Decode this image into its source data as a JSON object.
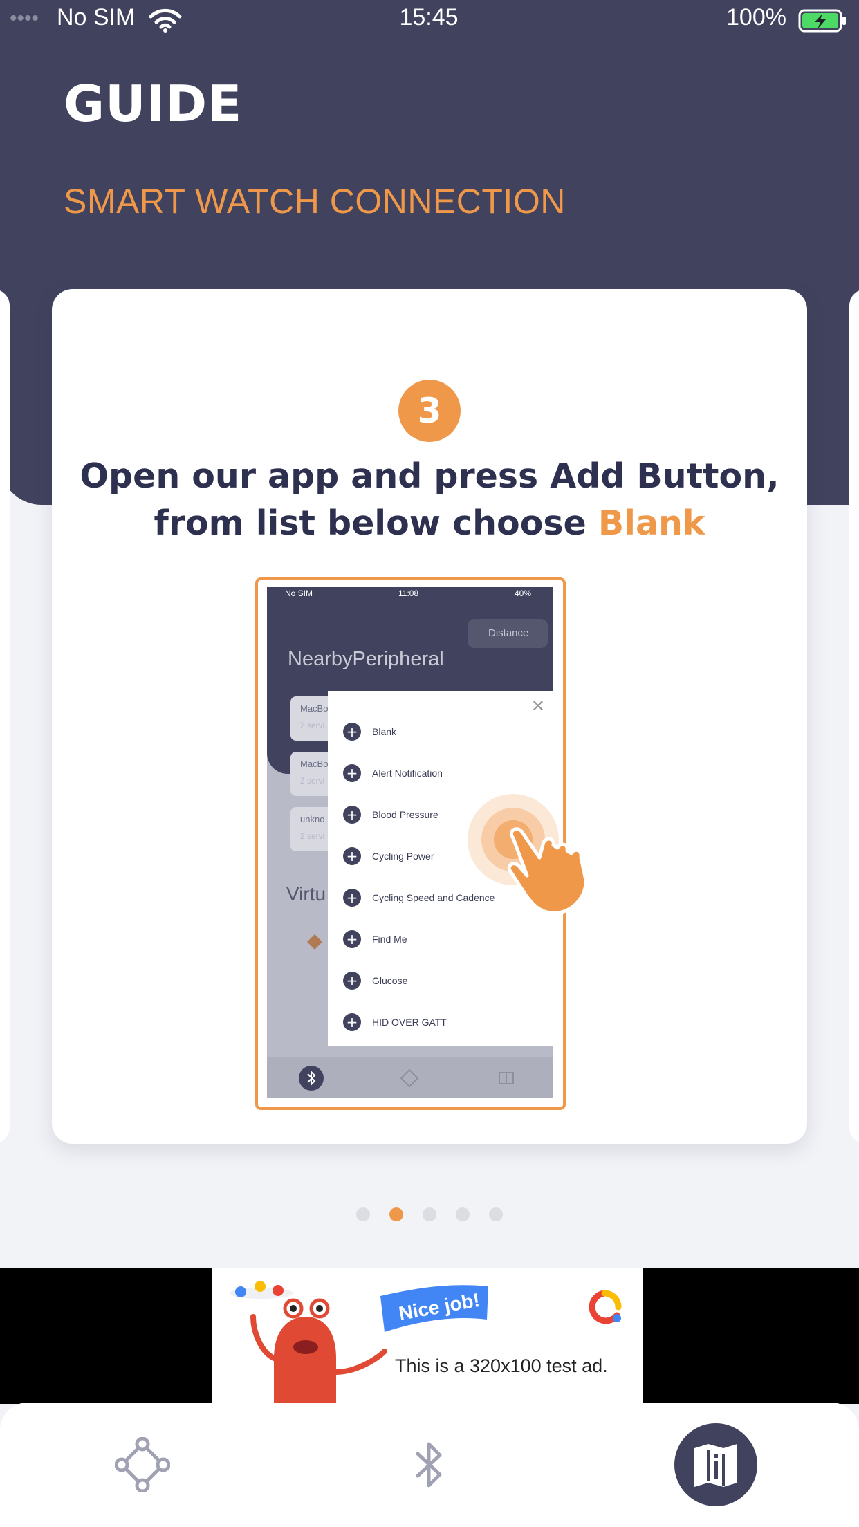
{
  "status_bar": {
    "carrier": "No SIM",
    "time": "15:45",
    "battery": "100%"
  },
  "header": {
    "title": "GUIDE",
    "subtitle": "SMART WATCH CONNECTION"
  },
  "guide_card": {
    "step_number": "3",
    "instruction_main": "Open our app and press Add Button, from list below choose ",
    "instruction_highlight": "Blank"
  },
  "mini_screenshot": {
    "status": {
      "carrier": "No SIM",
      "time": "11:08",
      "battery": "40%"
    },
    "distance_button": "Distance",
    "heading": "NearbyPeripheral",
    "peripherals": [
      {
        "name": "MacBo",
        "detail": "2 servi"
      },
      {
        "name": "MacBo",
        "detail": "2 servi"
      },
      {
        "name": "unkno",
        "detail": "2 servi"
      }
    ],
    "virtual_heading": "Virtu",
    "popup_close": "✕",
    "popup_items": [
      "Blank",
      "Alert Notification",
      "Blood Pressure",
      "Cycling Power",
      "Cycling Speed and Cadence",
      "Find Me",
      "Glucose",
      "HID OVER GATT"
    ],
    "plus_symbol": "+"
  },
  "pager": {
    "count": 5,
    "active_index": 1
  },
  "ad": {
    "banner": "Nice job!",
    "text": "This is a 320x100 test ad."
  },
  "tab_bar": {
    "items": [
      {
        "icon": "peripheral-diamond-icon",
        "active": false
      },
      {
        "icon": "bluetooth-icon",
        "active": false
      },
      {
        "icon": "guide-book-icon",
        "active": true
      }
    ]
  },
  "colors": {
    "primary_dark": "#41435e",
    "accent_orange": "#f0984a",
    "background": "#f2f3f7"
  }
}
